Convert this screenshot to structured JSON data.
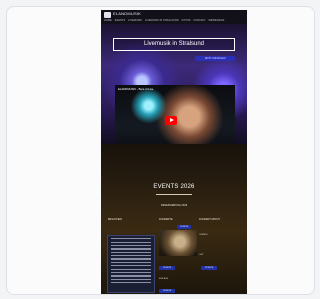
{
  "site": {
    "brand": "ELANDMUSIK",
    "nav": [
      "HOME",
      "EVENTS",
      "LIVEMUSIK",
      "LIVEMUSIK IN STRALSUND",
      "FOTOS",
      "KONTAKT",
      "IMPRESSUM"
    ]
  },
  "hero": {
    "title": "Livemusik in Stralsund",
    "button": "JETZT ANFRAGEN"
  },
  "video": {
    "title": "ELANDMUSIK - Best of Live"
  },
  "events": {
    "title": "EVENTS 2026",
    "dropdown": "RESERVIERUNG 2026",
    "col_left": "BESUCHER",
    "col_mid": "KONZERTE",
    "col_right": "KONZERT ABOUT",
    "chips": [
      "TICKETS",
      "TICKETS",
      "TICKETS",
      "TICKETS"
    ],
    "labels": [
      "TERMIN",
      "ORT",
      "EINLASS"
    ]
  },
  "colors": {
    "accent": "#2b2fb5",
    "play": "#ff0000",
    "card_bg": "#fbfbfc",
    "page_bg": "#f3f4f6"
  }
}
